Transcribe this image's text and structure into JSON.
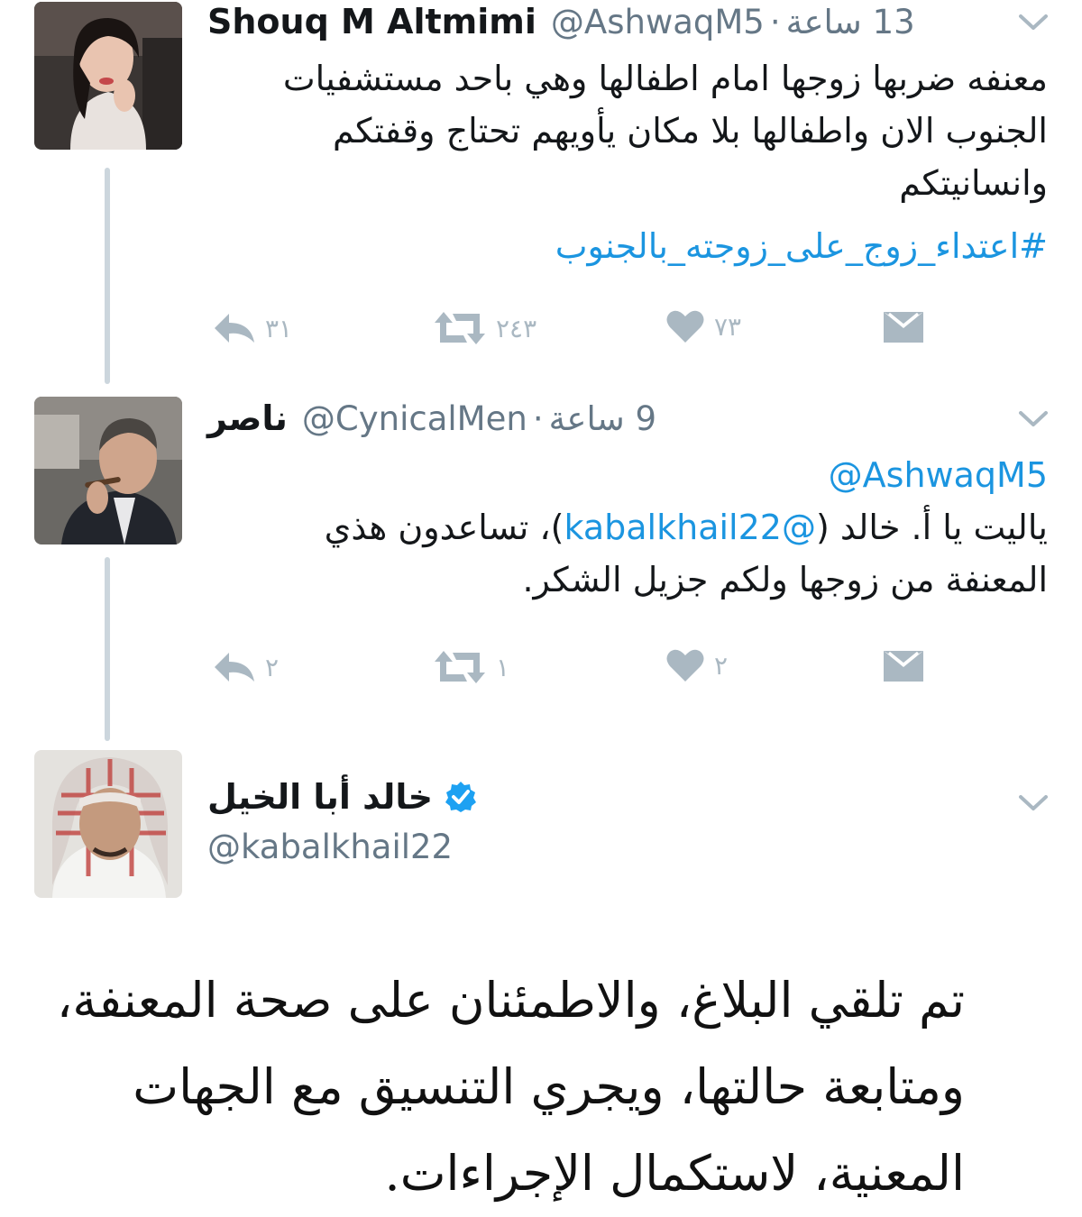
{
  "tweets": [
    {
      "name": "Shouq M Altmimi",
      "handle": "@AshwaqM5",
      "time": "13 ساعة",
      "body_lines": [
        "معنفه ضربها زوجها امام اطفالها وهي باحد مستشفيات",
        "الجنوب الان واطفالها بلا مكان يأويهم تحتاج وقفتكم",
        "وانسانيتكم"
      ],
      "hashtag": "#اعتداء_زوج_على_زوجته_بالجنوب",
      "actions": {
        "replies": "٣١",
        "retweets": "٢٤٣",
        "likes": "٧٣"
      }
    },
    {
      "name": "ناصر",
      "handle": "@CynicalMen",
      "time": "9 ساعة",
      "mention": "@AshwaqM5",
      "line1_pre": "ياليت يا أ. خالد (",
      "line1_link": "@kabalkhail22",
      "line1_post": ")، تساعدون هذي",
      "line2": "المعنفة من زوجها ولكم جزيل الشكر.",
      "actions": {
        "replies": "٢",
        "retweets": "١",
        "likes": "٢"
      }
    },
    {
      "name": "خالد أبا الخيل",
      "handle": "@kabalkhail22",
      "body_lines": [
        "تم تلقي البلاغ، والاطمئنان على صحة المعنفة،",
        "ومتابعة حالتها، ويجري التنسيق مع الجهات",
        "المعنية، لاستكمال الإجراءات."
      ]
    }
  ],
  "icons": [
    "reply-icon",
    "retweet-icon",
    "like-icon",
    "dm-icon",
    "chevron-down-icon",
    "verified-icon"
  ],
  "colors": {
    "link": "#1b95e0",
    "muted": "#657786",
    "action": "#aab8c2",
    "thread": "#ccd6dd",
    "verified": "#1da1f2"
  }
}
